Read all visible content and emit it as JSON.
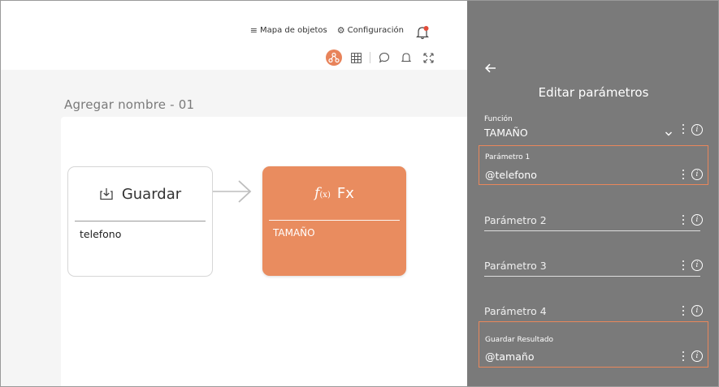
{
  "topbar": {
    "object_map_icon": "hamburger-icon",
    "object_map_label": "Mapa de objetos",
    "settings_icon": "gear-icon",
    "settings_label": "Configuración",
    "notifications_icon": "bell-icon"
  },
  "toolbar": {
    "items": [
      "flow-icon",
      "grid-icon",
      "comment-icon",
      "bell-outline-icon",
      "expand-icon"
    ],
    "active_index": 0
  },
  "canvas": {
    "flow_name": "Agregar nombre - 01",
    "save_node": {
      "icon": "download-box-icon",
      "title": "Guardar",
      "value": "telefono"
    },
    "fx_node": {
      "icon": "function-icon",
      "glyph": "f",
      "glyph_sub": "(x)",
      "title": "Fx",
      "value": "TAMAÑO"
    }
  },
  "panel": {
    "title": "Editar parámetros",
    "function": {
      "label": "Función",
      "value": "TAMAÑO"
    },
    "param1": {
      "label": "Parámetro 1",
      "value": "@telefono"
    },
    "param2": {
      "placeholder": "Parámetro 2"
    },
    "param3": {
      "placeholder": "Parámetro 3"
    },
    "param4": {
      "placeholder": "Parámetro 4"
    },
    "result": {
      "label": "Guardar Resultado",
      "value": "@tamaño"
    },
    "info_glyph": "i"
  },
  "colors": {
    "accent": "#e98c5f",
    "panel_bg": "#7a7a7a",
    "highlight_border": "#e9875b",
    "canvas_bg": "#f5f5f5"
  }
}
